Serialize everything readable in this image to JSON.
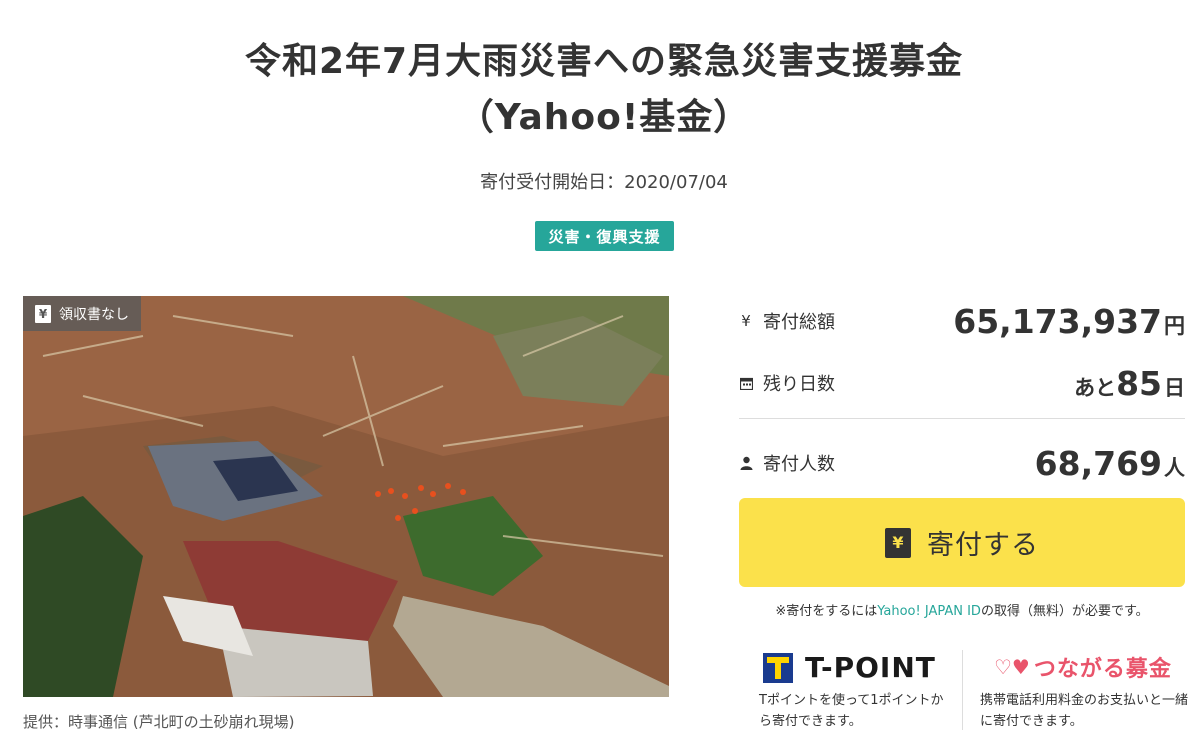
{
  "header": {
    "title_line1": "令和2年7月大雨災害への緊急災害支援募金",
    "title_line2": "（Yahoo!基金）",
    "start_date": "寄付受付開始日：2020/07/04",
    "category": "災害・復興支援"
  },
  "photo": {
    "receipt_icon": "¥",
    "receipt_label": "領収書なし",
    "credit": "提供：時事通信 (芦北町の土砂崩れ現場)"
  },
  "stats": {
    "total": {
      "icon": "yen-icon",
      "label": "寄付総額",
      "value": "65,173,937",
      "unit": "円"
    },
    "remaining": {
      "icon": "calendar-icon",
      "label": "残り日数",
      "prefix": "あと",
      "value": "85",
      "unit": "日"
    },
    "donors": {
      "icon": "person-icon",
      "label": "寄付人数",
      "value": "68,769",
      "unit": "人"
    }
  },
  "donate": {
    "icon": "¥",
    "label": "寄付する"
  },
  "id_note": {
    "prefix": "※寄付をするには",
    "link": "Yahoo! JAPAN ID",
    "suffix": "の取得（無料）が必要です。"
  },
  "tpoint": {
    "name": "T-POINT",
    "desc": "Tポイントを使って1ポイントから寄付できます。"
  },
  "tsunagaru": {
    "name": "つながる募金",
    "desc": "携帯電話利用料金のお支払いと一緒に寄付できます。"
  },
  "colors": {
    "accent": "#26a69a",
    "button": "#fbe14b",
    "tpoint_blue": "#1a3b8f",
    "tpoint_yellow": "#ffd400",
    "tsunagaru_pink": "#e9546b"
  }
}
